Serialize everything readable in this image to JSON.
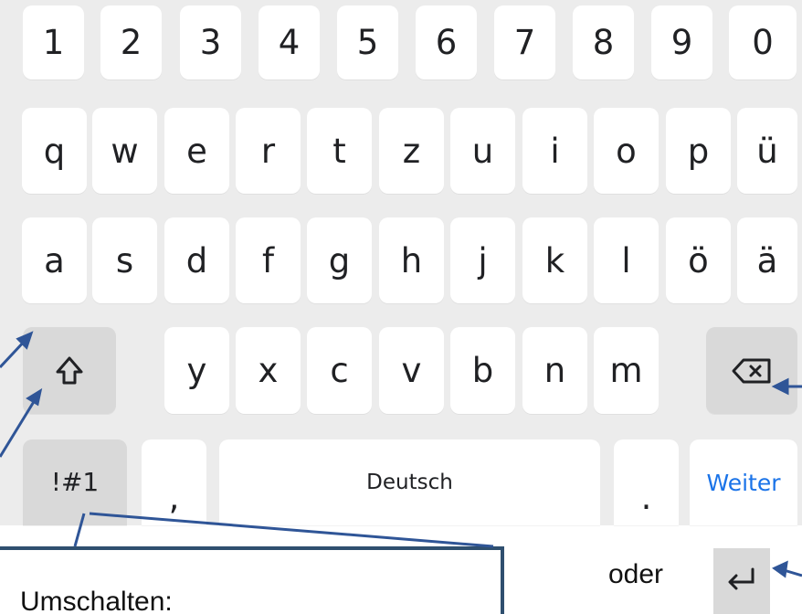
{
  "keyboard": {
    "row1": [
      "1",
      "2",
      "3",
      "4",
      "5",
      "6",
      "7",
      "8",
      "9",
      "0"
    ],
    "row2": [
      "q",
      "w",
      "e",
      "r",
      "t",
      "z",
      "u",
      "i",
      "o",
      "p",
      "ü"
    ],
    "row3": [
      "a",
      "s",
      "d",
      "f",
      "g",
      "h",
      "j",
      "k",
      "l",
      "ö",
      "ä"
    ],
    "row4": [
      "y",
      "x",
      "c",
      "v",
      "b",
      "n",
      "m"
    ],
    "symbols_label": "!#1",
    "comma_label": ",",
    "space_label": "Deutsch",
    "period_label": ".",
    "action_label": "Weiter",
    "shift_icon": "shift-icon",
    "backspace_icon": "backspace-icon"
  },
  "annotations": {
    "callout_text": "Umschalten:",
    "or_text": "oder",
    "enter_icon": "enter-icon",
    "arrow_color": "#2f5597"
  },
  "colors": {
    "keyboard_bg": "#ececec",
    "key_bg": "#ffffff",
    "special_key_bg": "#d9d9d9",
    "key_text": "#202124",
    "action_text": "#1a73e8"
  }
}
